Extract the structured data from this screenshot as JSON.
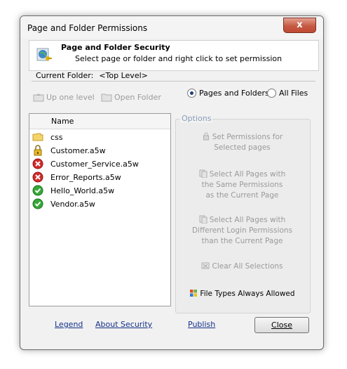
{
  "window": {
    "title": "Page and Folder Permissions",
    "close_glyph": "x"
  },
  "header": {
    "title": "Page and Folder Security",
    "subtitle": "Select page or folder and right click to set permission",
    "icon": "security-globe-icon"
  },
  "current_folder": {
    "label": "Current Folder:",
    "value": "<Top Level>"
  },
  "toolbar": {
    "up_label": "Up one level",
    "open_label": "Open Folder"
  },
  "view_mode": {
    "options": [
      "Pages and Folders",
      "All Files"
    ],
    "selected": "Pages and Folders"
  },
  "file_list": {
    "column": "Name",
    "items": [
      {
        "name": "css",
        "icon": "folder-icon"
      },
      {
        "name": "Customer.a5w",
        "icon": "lock-icon"
      },
      {
        "name": "Customer_Service.a5w",
        "icon": "error-icon"
      },
      {
        "name": "Error_Reports.a5w",
        "icon": "error-icon"
      },
      {
        "name": "Hello_World.a5w",
        "icon": "check-icon"
      },
      {
        "name": "Vendor.a5w",
        "icon": "check-icon"
      }
    ]
  },
  "options": {
    "label": "Options",
    "set_permissions": [
      "Set Permissions for",
      "Selected pages"
    ],
    "select_same": [
      "Select All Pages with",
      "the Same Permissions",
      "as the Current Page"
    ],
    "select_different": [
      "Select All Pages with",
      "Different Login Permissions",
      "than the Current Page"
    ],
    "clear": "Clear All Selections",
    "file_types": "File Types Always Allowed"
  },
  "footer": {
    "legend": "Legend",
    "about": "About Security",
    "publish": "Publish",
    "close": "Close"
  }
}
